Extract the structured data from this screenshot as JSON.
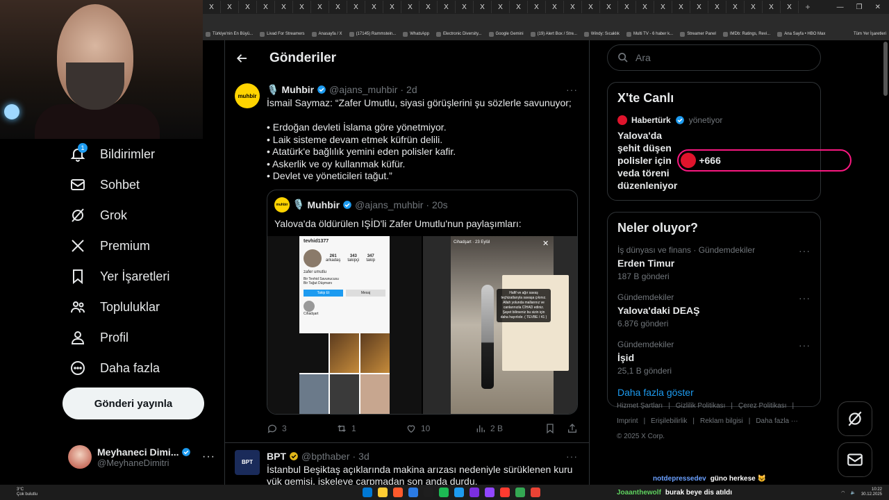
{
  "browser": {
    "tab_glyph": "X",
    "bookmarks": [
      "Türkiye'nin En Büyü...",
      "Livad For Streamers",
      "Anasayfa / X",
      "(17145) Rammstein...",
      "WhatsApp",
      "Electronic Diversity...",
      "Google Gemini",
      "(19) Alert Box / Stre...",
      "Windy: Sıcaklık",
      "Multi TV - 6 haber k...",
      "Streamer Panel",
      "IMDb: Ratings, Revi...",
      "Ana Sayfa • HBO Max"
    ],
    "bookmarks_all": "Tüm Yer İşaretleri"
  },
  "nav": {
    "items": [
      {
        "label": "Bildirimler",
        "icon": "bell-icon",
        "badge": "1"
      },
      {
        "label": "Sohbet",
        "icon": "mail-icon"
      },
      {
        "label": "Grok",
        "icon": "grok-icon"
      },
      {
        "label": "Premium",
        "icon": "x-logo-icon"
      },
      {
        "label": "Yer İşaretleri",
        "icon": "bookmark-icon"
      },
      {
        "label": "Topluluklar",
        "icon": "people-icon"
      },
      {
        "label": "Profil",
        "icon": "person-icon"
      },
      {
        "label": "Daha fazla",
        "icon": "more-circle-icon"
      }
    ],
    "post_button": "Gönderi yayınla"
  },
  "account": {
    "name": "Meyhaneci Dimi...",
    "handle": "@MeyhaneDimitri"
  },
  "main": {
    "title": "Gönderiler",
    "tweets": [
      {
        "name": "Muhbir",
        "emoji": "🎙️",
        "handle": "@ajans_muhbir",
        "time": "2d",
        "avatar_text": "muhbir",
        "text": "İsmail Saymaz: “Zafer Umutlu, siyasi görüşlerini şu sözlerle savunuyor;\n\n• Erdoğan devleti İslama göre yönetmiyor.\n• Laik sisteme devam etmek küfrün delili.\n• Atatürk'e bağlılık yemini eden polisler kafir.\n• Askerlik ve oy kullanmak küfür.\n• Devlet ve yöneticileri tağut.”",
        "quote": {
          "name": "Muhbir",
          "handle": "@ajans_muhbir",
          "time": "20s",
          "text": "Yalova'da öldürülen IŞİD'li Zafer Umutlu'nun paylaşımları:",
          "ig_user": "tevhid1377",
          "ig_name": "zafer umutlu",
          "ig_stats": [
            "261",
            "343",
            "347"
          ],
          "ig_stat_labels": [
            "arkadaş",
            "takipçi",
            "takip"
          ],
          "ig_bio": "Bir Tevhid Savunucusu\nBir Tağut Düşmanı",
          "ig_follow": "Takip Et",
          "ig_message": "Mesaj",
          "ig_highlight": "Cihadşart",
          "story_user": "Cihadşart · 23 Eylül",
          "story_note": "Hafif ve ağır savaş teçhizatlarıyla savaşa çıkınız. Allah yolunda mallarınız ve canlarınızla CİHAD ediniz. Şayet bilirseniz bu sizin için daha hayırlıdır. ( TEVBE / 41 )"
        },
        "actions": {
          "replies": "3",
          "reposts": "1",
          "likes": "10",
          "views": "2 B"
        }
      },
      {
        "name": "BPT",
        "handle": "@bpthaber",
        "time": "3d",
        "avatar_text": "BPT",
        "text": "İstanbul Beşiktaş açıklarında makina arızası nedeniyle sürüklenen kuru yük gemisi, iskeleye çarpmadan son anda durdu."
      }
    ]
  },
  "right": {
    "search_placeholder": "Ara",
    "live": {
      "title": "X'te Canlı",
      "host": "Habertürk",
      "role": "yönetiyor",
      "headline": "Yalova'da şehit düşen polisler için veda töreni düzenleniyor",
      "count": "+666"
    },
    "trends_title": "Neler oluyor?",
    "trends": [
      {
        "category": "İş dünyası ve finans · Gündemdekiler",
        "title": "Erden Timur",
        "count": "187 B gönderi"
      },
      {
        "category": "Gündemdekiler",
        "title": "Yalova'daki DEAŞ",
        "count": "6.876 gönderi"
      },
      {
        "category": "Gündemdekiler",
        "title": "İşid",
        "count": "25,1 B gönderi"
      }
    ],
    "show_more": "Daha fazla göster",
    "footer_links": [
      "Hizmet Şartları",
      "|",
      "Gizlilik Politikası",
      "|",
      "Çerez Politikası",
      "|",
      "Imprint",
      "|",
      "Erişilebilirlik",
      "|",
      "Reklam bilgisi",
      "|",
      "Daha fazla ···"
    ],
    "copyright": "© 2025 X Corp."
  },
  "chat": [
    {
      "user": "notdepressedev",
      "msg": "güno herkese 😺"
    },
    {
      "user": "Joaanthewolf",
      "msg": "burak beye dis atıldı"
    }
  ],
  "taskbar": {
    "temp": "3°C",
    "weather": "Çok bulutlu",
    "time": "10:22",
    "date": "30.12.2025",
    "icon_colors": [
      "#0078d4",
      "#ffcc33",
      "#ff5a2c",
      "#2b7be4",
      "#1e1e1e",
      "#1db954",
      "#1d9bf0",
      "#7b2fe0",
      "#9146ff",
      "#ff3b30",
      "#34a853",
      "#ea4335"
    ]
  },
  "colors": {
    "accent": "#1d9bf0",
    "live_border": "#f91880",
    "brand_yellow": "#ffd400"
  }
}
